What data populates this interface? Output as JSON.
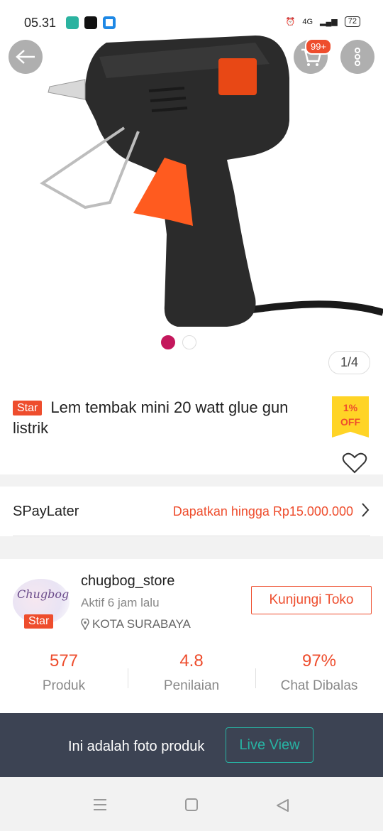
{
  "status_bar": {
    "time": "05.31",
    "network": "4G",
    "battery": "72"
  },
  "gallery": {
    "counter": "1/4",
    "cart_badge": "99+",
    "dots_total": 2,
    "dot_active": 1
  },
  "product": {
    "badge": "Star",
    "title": "Lem tembak mini 20 watt glue gun listrik",
    "discount": "1%",
    "discount_suffix": "OFF"
  },
  "spaylater": {
    "label": "SPayLater",
    "value": "Dapatkan hingga Rp15.000.000"
  },
  "shop": {
    "logo_text": "Chugbog",
    "badge": "Star",
    "name": "chugbog_store",
    "active": "Aktif 6 jam lalu",
    "location": "KOTA SURABAYA",
    "visit_label": "Kunjungi Toko",
    "stats": [
      {
        "value": "577",
        "label": "Produk"
      },
      {
        "value": "4.8",
        "label": "Penilaian"
      },
      {
        "value": "97%",
        "label": "Chat Dibalas"
      }
    ]
  },
  "photo_bar": {
    "text": "Ini adalah foto produk",
    "button": "Live View"
  },
  "colors": {
    "accent": "#ee4d2d",
    "live": "#27b3a3",
    "bar": "#3c4353"
  }
}
